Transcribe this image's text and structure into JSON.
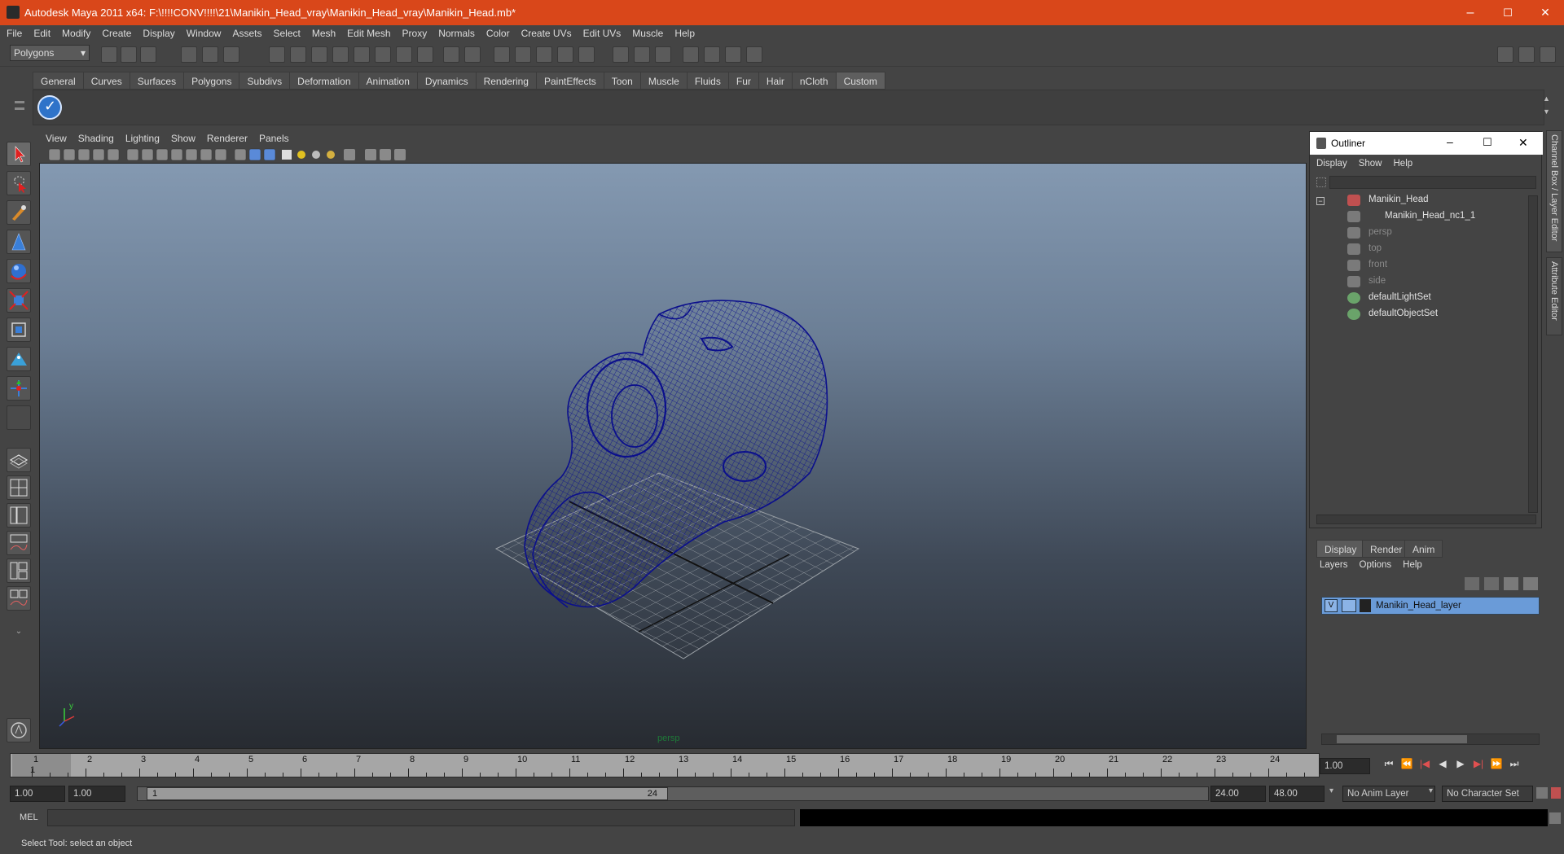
{
  "window": {
    "title": "Autodesk Maya 2011 x64: F:\\!!!!CONV!!!!\\21\\Manikin_Head_vray\\Manikin_Head_vray\\Manikin_Head.mb*",
    "minimize": "–",
    "maximize": "☐",
    "close": "✕"
  },
  "menubar": [
    "File",
    "Edit",
    "Modify",
    "Create",
    "Display",
    "Window",
    "Assets",
    "Select",
    "Mesh",
    "Edit Mesh",
    "Proxy",
    "Normals",
    "Color",
    "Create UVs",
    "Edit UVs",
    "Muscle",
    "Help"
  ],
  "statusline": {
    "mode": "Polygons"
  },
  "shelf": {
    "tabs": [
      "General",
      "Curves",
      "Surfaces",
      "Polygons",
      "Subdivs",
      "Deformation",
      "Animation",
      "Dynamics",
      "Rendering",
      "PaintEffects",
      "Toon",
      "Muscle",
      "Fluids",
      "Fur",
      "Hair",
      "nCloth",
      "Custom"
    ],
    "active_tab": "Custom"
  },
  "panel": {
    "menus": [
      "View",
      "Shading",
      "Lighting",
      "Show",
      "Renderer",
      "Panels"
    ],
    "camera": "persp"
  },
  "side_tabs": {
    "channel_box": "Channel Box / Layer Editor",
    "attribute_editor": "Attribute Editor"
  },
  "outliner": {
    "title": "Outliner",
    "menus": [
      "Display",
      "Show",
      "Help"
    ],
    "items": [
      {
        "label": "Manikin_Head",
        "dim": false
      },
      {
        "label": "Manikin_Head_nc1_1",
        "dim": false
      },
      {
        "label": "persp",
        "dim": true
      },
      {
        "label": "top",
        "dim": true
      },
      {
        "label": "front",
        "dim": true
      },
      {
        "label": "side",
        "dim": true
      },
      {
        "label": "defaultLightSet",
        "dim": false
      },
      {
        "label": "defaultObjectSet",
        "dim": false
      }
    ]
  },
  "layer_editor": {
    "tabs": [
      "Display",
      "Render",
      "Anim"
    ],
    "menus": [
      "Layers",
      "Options",
      "Help"
    ],
    "layer": {
      "visible": "V",
      "name": "Manikin_Head_layer"
    }
  },
  "timeline": {
    "ticks": [
      "1",
      "2",
      "3",
      "4",
      "5",
      "6",
      "7",
      "8",
      "9",
      "10",
      "11",
      "12",
      "13",
      "14",
      "15",
      "16",
      "17",
      "18",
      "19",
      "20",
      "21",
      "22",
      "23",
      "24"
    ],
    "current": "1",
    "current_field": "1.00"
  },
  "range": {
    "start": "1.00",
    "playback_start": "1.00",
    "handle_start": "1",
    "handle_end": "24",
    "playback_end": "24.00",
    "end": "48.00",
    "anim_layer": "No Anim Layer",
    "character_set": "No Character Set"
  },
  "mel": {
    "label": "MEL"
  },
  "status": {
    "help": "Select Tool: select an object"
  },
  "colors": {
    "titlebar": "#d9471a",
    "wireframe": "#0b0f8c",
    "layer_highlight": "#6a9bd8"
  }
}
